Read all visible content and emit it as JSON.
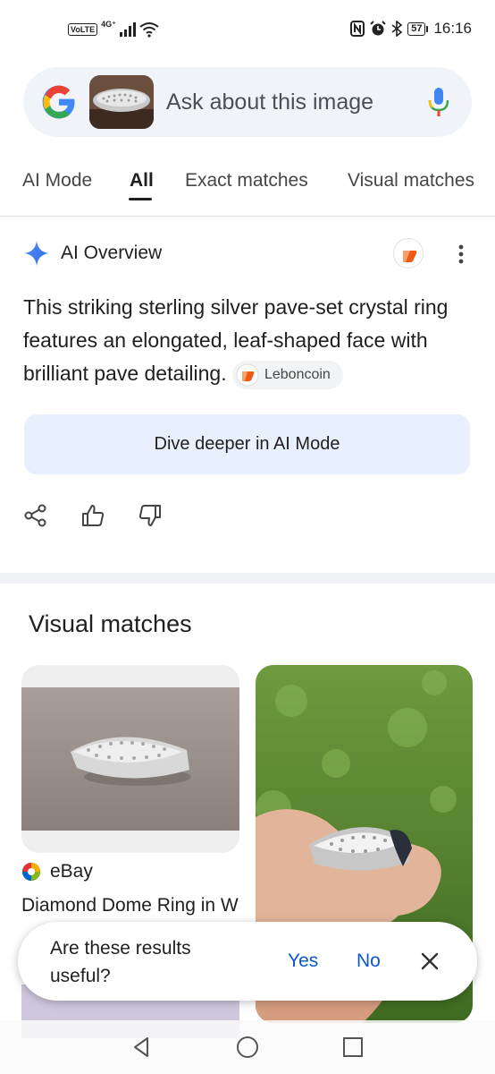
{
  "status_bar": {
    "volte": "VoLTE",
    "network": "4G⁺",
    "battery": "57",
    "time": "16:16"
  },
  "search": {
    "placeholder": "Ask about this image"
  },
  "tabs": [
    {
      "label": "AI Mode"
    },
    {
      "label": "All",
      "active": true
    },
    {
      "label": "Exact matches"
    },
    {
      "label": "Visual matches"
    }
  ],
  "ai_overview": {
    "title": "AI Overview",
    "body": "This striking sterling silver pave-set crystal ring features an elongated, leaf-shaped face with brilliant pave detailing.",
    "source_chip": "Leboncoin",
    "dive_button": "Dive deeper in AI Mode"
  },
  "visual_matches": {
    "title": "Visual matches",
    "cards": [
      {
        "source": "eBay",
        "title": "Diamond Dome Ring in W"
      }
    ]
  },
  "feedback": {
    "question": "Are these results useful?",
    "yes": "Yes",
    "no": "No"
  },
  "colors": {
    "accent_blue": "#0b57d0",
    "search_bg": "#f0f3f8",
    "dive_bg": "#e8f0fd"
  }
}
